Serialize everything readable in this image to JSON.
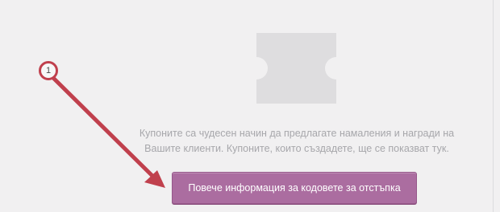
{
  "annotation": {
    "step_number": "1",
    "color": "#c0404d"
  },
  "empty_state": {
    "icon": "coupon-ticket-icon",
    "message_lines": [
      "Купоните са чудесен начин да предлагате намаления и награди на",
      "Вашите клиенти. Купоните, които създадете, ще се показват тук."
    ],
    "button_label": "Повече информация за кодовете за отстъпка",
    "accent_color": "#ab6da0"
  }
}
